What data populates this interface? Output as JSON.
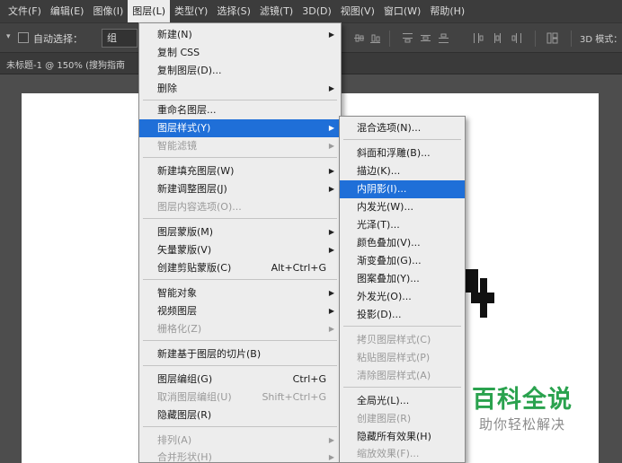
{
  "menubar": {
    "items": [
      {
        "label": "文件(F)"
      },
      {
        "label": "编辑(E)"
      },
      {
        "label": "图像(I)"
      },
      {
        "label": "图层(L)"
      },
      {
        "label": "类型(Y)"
      },
      {
        "label": "选择(S)"
      },
      {
        "label": "滤镜(T)"
      },
      {
        "label": "3D(D)"
      },
      {
        "label": "视图(V)"
      },
      {
        "label": "窗口(W)"
      },
      {
        "label": "帮助(H)"
      }
    ]
  },
  "options_bar": {
    "auto_select_label": "自动选择：",
    "auto_select_checked": false,
    "auto_select_value": "组",
    "mode_3d_label": "3D 模式："
  },
  "document": {
    "tab_title": "未标题-1 @ 150% (搜狗指南"
  },
  "layer_menu": {
    "items": [
      {
        "label": "新建(N)",
        "submenu": true
      },
      {
        "label": "复制 CSS"
      },
      {
        "label": "复制图层(D)..."
      },
      {
        "label": "删除",
        "submenu": true
      },
      {
        "label": "重命名图层..."
      },
      {
        "label": "图层样式(Y)",
        "submenu": true,
        "highlighted": true
      },
      {
        "label": "智能滤镜",
        "submenu": true,
        "disabled": true
      },
      {
        "label": "新建填充图层(W)",
        "submenu": true
      },
      {
        "label": "新建调整图层(J)",
        "submenu": true
      },
      {
        "label": "图层内容选项(O)...",
        "disabled": true
      },
      {
        "label": "图层蒙版(M)",
        "submenu": true
      },
      {
        "label": "矢量蒙版(V)",
        "submenu": true
      },
      {
        "label": "创建剪贴蒙版(C)",
        "shortcut": "Alt+Ctrl+G"
      },
      {
        "label": "智能对象",
        "submenu": true
      },
      {
        "label": "视频图层",
        "submenu": true
      },
      {
        "label": "栅格化(Z)",
        "submenu": true,
        "disabled": true
      },
      {
        "label": "新建基于图层的切片(B)"
      },
      {
        "label": "图层编组(G)",
        "shortcut": "Ctrl+G"
      },
      {
        "label": "取消图层编组(U)",
        "shortcut": "Shift+Ctrl+G",
        "disabled": true
      },
      {
        "label": "隐藏图层(R)"
      },
      {
        "label": "排列(A)",
        "submenu": true,
        "disabled": true
      },
      {
        "label": "合并形状(H)",
        "submenu": true,
        "disabled": true
      }
    ]
  },
  "layer_style_submenu": {
    "items": [
      {
        "label": "混合选项(N)..."
      },
      {
        "label": "斜面和浮雕(B)..."
      },
      {
        "label": "描边(K)..."
      },
      {
        "label": "内阴影(I)...",
        "highlighted": true
      },
      {
        "label": "内发光(W)..."
      },
      {
        "label": "光泽(T)..."
      },
      {
        "label": "颜色叠加(V)..."
      },
      {
        "label": "渐变叠加(G)..."
      },
      {
        "label": "图案叠加(Y)..."
      },
      {
        "label": "外发光(O)..."
      },
      {
        "label": "投影(D)..."
      },
      {
        "label": "拷贝图层样式(C)",
        "disabled": true
      },
      {
        "label": "粘贴图层样式(P)",
        "disabled": true
      },
      {
        "label": "清除图层样式(A)",
        "disabled": true
      },
      {
        "label": "全局光(L)..."
      },
      {
        "label": "创建图层(R)",
        "disabled": true
      },
      {
        "label": "隐藏所有效果(H)"
      },
      {
        "label": "缩放效果(F)...",
        "disabled": true
      }
    ]
  },
  "watermark": {
    "title": "百科全说",
    "subtitle": "助你轻松解决"
  },
  "colors": {
    "menu_highlight": "#1f6fd8",
    "watermark_green": "#2aa24e"
  }
}
